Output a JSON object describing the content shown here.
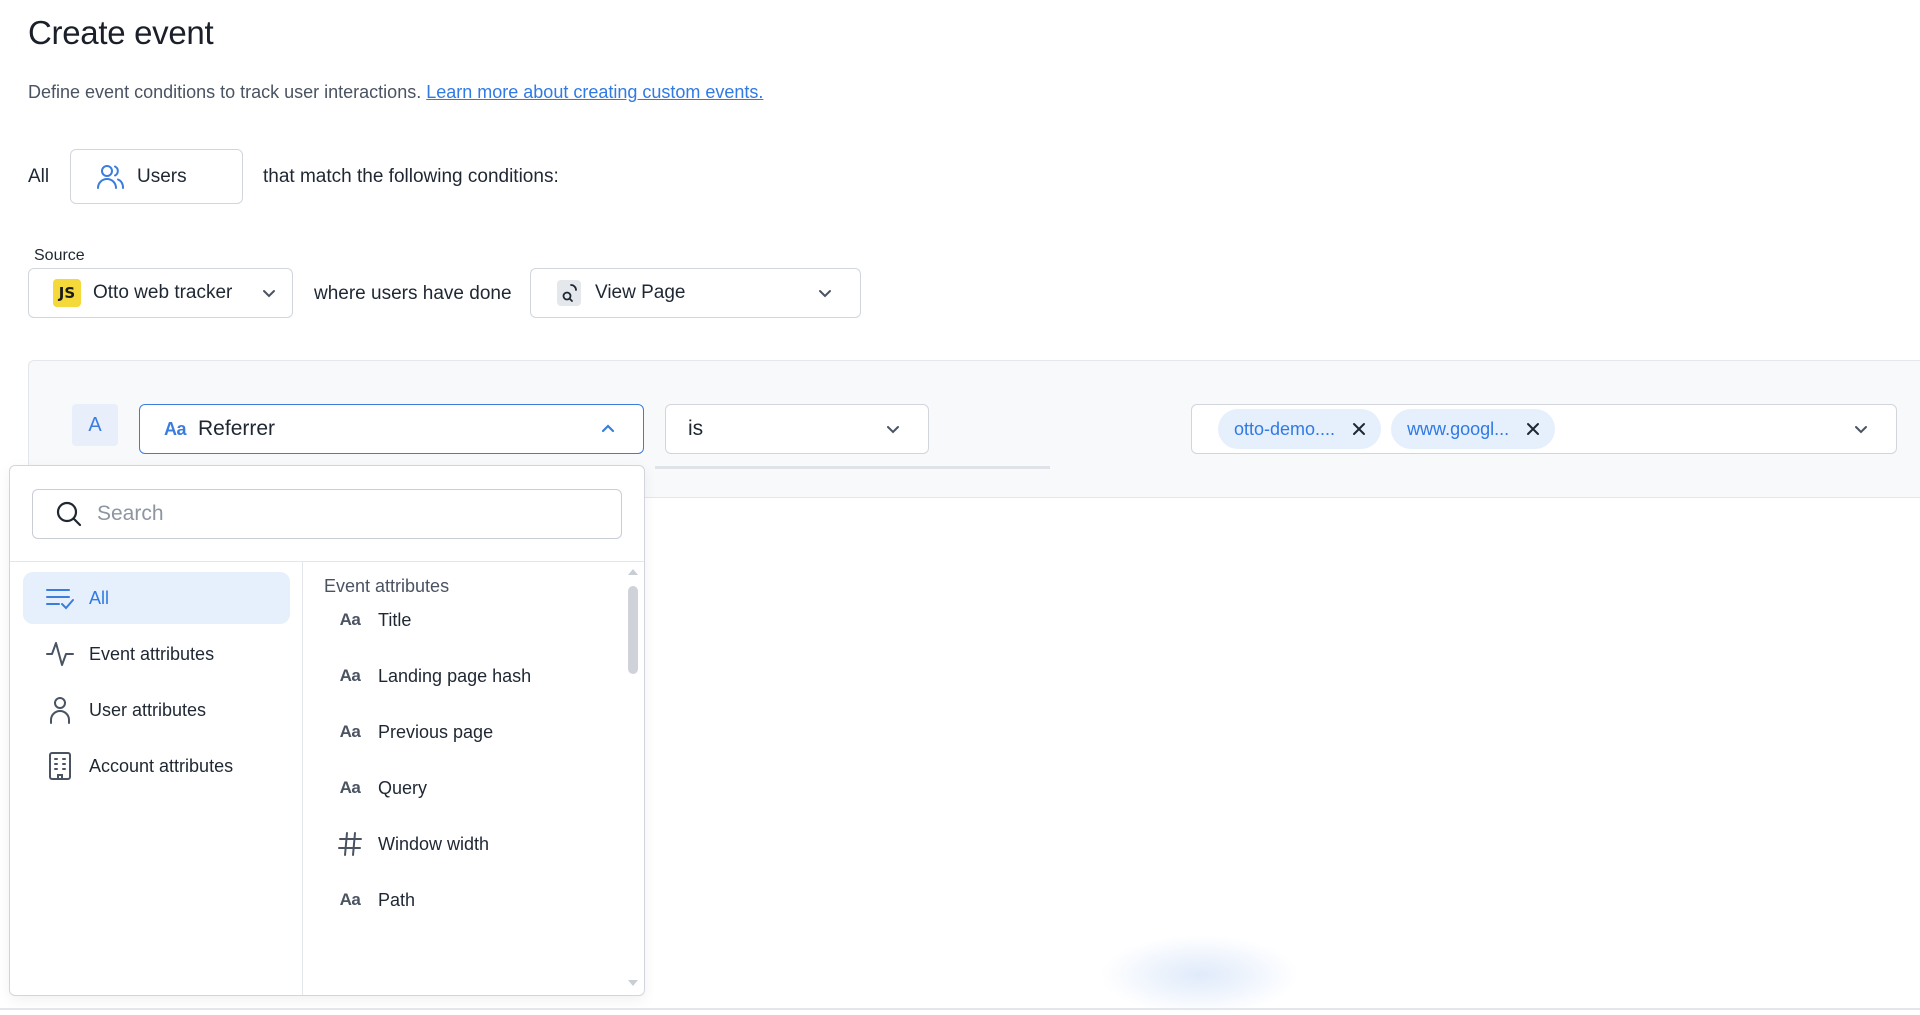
{
  "header": {
    "title": "Create event",
    "description": "Define event conditions to track user interactions.",
    "learn_more": "Learn more about creating custom events."
  },
  "audience": {
    "prefix": "All",
    "selected": "Users",
    "suffix": "that match the following conditions:",
    "icon": "users-icon"
  },
  "source": {
    "label": "Source",
    "badge": "JS",
    "value": "Otto web tracker",
    "connector": "where users have done",
    "event_value": "View Page"
  },
  "condition": {
    "letter": "A",
    "attribute": "Referrer",
    "operator": "is",
    "values": [
      "otto-demo....",
      "www.googl..."
    ]
  },
  "dropdown": {
    "search_placeholder": "Search",
    "categories": [
      {
        "label": "All",
        "icon": "list-check-icon",
        "active": true
      },
      {
        "label": "Event attributes",
        "icon": "activity-icon",
        "active": false
      },
      {
        "label": "User attributes",
        "icon": "user-icon",
        "active": false
      },
      {
        "label": "Account attributes",
        "icon": "building-icon",
        "active": false
      }
    ],
    "list_header": "Event attributes",
    "items": [
      {
        "label": "Title",
        "icon": "text-type-icon"
      },
      {
        "label": "Landing page hash",
        "icon": "text-type-icon"
      },
      {
        "label": "Previous page",
        "icon": "text-type-icon"
      },
      {
        "label": "Query",
        "icon": "text-type-icon"
      },
      {
        "label": "Window width",
        "icon": "hash-icon"
      },
      {
        "label": "Path",
        "icon": "text-type-icon"
      }
    ]
  },
  "colors": {
    "accent": "#3b7ddd",
    "link": "#2f7ae5",
    "chip_bg": "#e6effc",
    "js_badge": "#f5d93a"
  }
}
